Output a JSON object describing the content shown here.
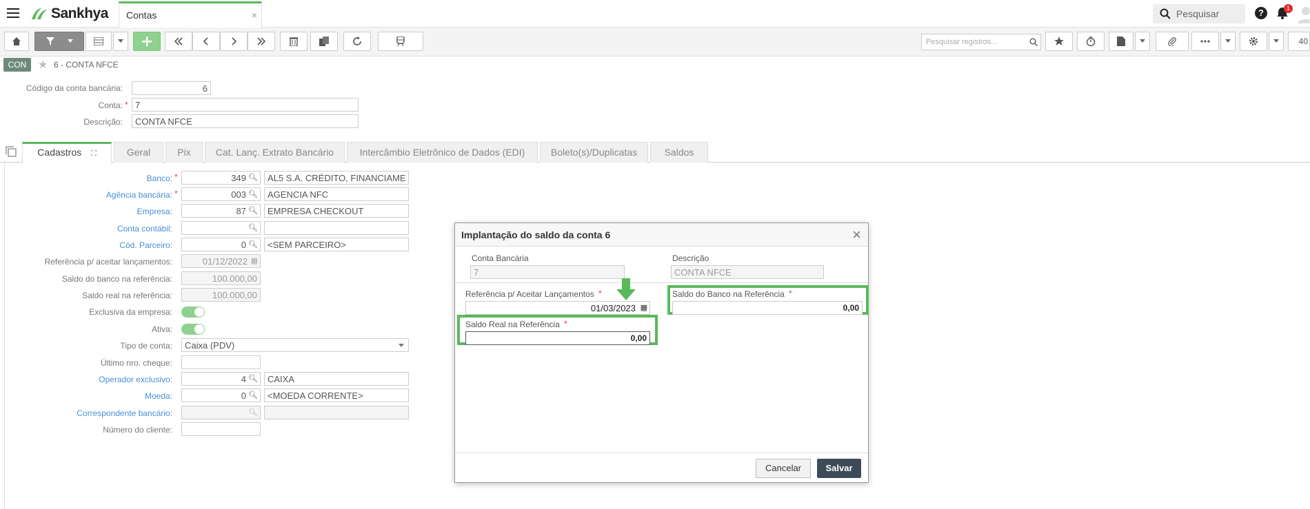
{
  "header": {
    "brand": "Sankhya",
    "tab_title": "Contas",
    "tab_close": "×",
    "search_label": "Pesquisar",
    "help": "?",
    "notifications_count": "1"
  },
  "toolbar": {
    "search_placeholder": "Pesquisar registros...",
    "page_size": "40"
  },
  "record": {
    "badge": "CON",
    "title": "6 - CONTA NFCE",
    "codigo_label": "Código da conta bancária:",
    "codigo_value": "6",
    "conta_label": "Conta:",
    "conta_value": "7",
    "descricao_label": "Descrição:",
    "descricao_value": "CONTA NFCE"
  },
  "tabs": [
    {
      "label": "Cadastros"
    },
    {
      "label": "Geral"
    },
    {
      "label": "Pix"
    },
    {
      "label": "Cat. Lanç. Extrato Bancário"
    },
    {
      "label": "Intercâmbio Eletrônico de Dados (EDI)"
    },
    {
      "label": "Boleto(s)/Duplicatas"
    },
    {
      "label": "Saldos"
    }
  ],
  "form": {
    "banco_label": "Banco:",
    "banco_code": "349",
    "banco_name": "AL5 S.A. CRÉDITO, FINANCIAME",
    "agencia_label": "Agência bancária:",
    "agencia_code": "003",
    "agencia_name": "AGENCIA NFC",
    "empresa_label": "Empresa:",
    "empresa_code": "87",
    "empresa_name": "EMPRESA CHECKOUT",
    "conta_contabil_label": "Conta contábil:",
    "parceiro_label": "Cód. Parceiro:",
    "parceiro_code": "0",
    "parceiro_name": "<SEM PARCEIRO>",
    "referencia_label": "Referência p/ aceitar lançamentos:",
    "referencia_value": "01/12/2022",
    "saldo_banco_label": "Saldo do banco na referência:",
    "saldo_banco_value": "100.000,00",
    "saldo_real_label": "Saldo real na referência:",
    "saldo_real_value": "100.000,00",
    "exclusiva_label": "Exclusiva da empresa:",
    "ativa_label": "Ativa:",
    "tipo_label": "Tipo de conta:",
    "tipo_value": "Caixa (PDV)",
    "ultimo_cheque_label": "Último nro. cheque:",
    "operador_label": "Operador exclusivo:",
    "operador_code": "4",
    "operador_name": "CAIXA",
    "moeda_label": "Moeda:",
    "moeda_code": "0",
    "moeda_name": "<MOEDA CORRENTE>",
    "correspondente_label": "Correspondente bancário:",
    "numero_cliente_label": "Número do cliente:"
  },
  "modal": {
    "title": "Implantação do saldo da conta 6",
    "close": "×",
    "conta_bancaria_label": "Conta Bancária",
    "conta_bancaria_value": "7",
    "descricao_label": "Descrição",
    "descricao_value": "CONTA NFCE",
    "referencia_label": "Referência p/ Aceitar Lançamentos",
    "referencia_value": "01/03/2023",
    "saldo_banco_label": "Saldo do Banco na Referência",
    "saldo_banco_value": "0,00",
    "saldo_real_label": "Saldo Real na Referência",
    "saldo_real_value": "0,00",
    "cancel_label": "Cancelar",
    "save_label": "Salvar",
    "highlight_color": "#5cb85c"
  },
  "colors": {
    "accent_green": "#5cb85c",
    "link_blue": "#4a8fd6",
    "required_red": "#e04040",
    "save_button": "#3d4a57"
  },
  "icons": [
    "menu-icon",
    "sankhya-logo-icon",
    "search-icon",
    "help-icon",
    "bell-icon",
    "user-icon",
    "home-icon",
    "filter-icon",
    "grid-icon",
    "plus-icon",
    "first-page-icon",
    "prev-icon",
    "next-icon",
    "last-page-icon",
    "trash-icon",
    "copy-icon",
    "refresh-icon",
    "train-icon",
    "star-icon",
    "timer-icon",
    "report-icon",
    "attach-icon",
    "more-icon",
    "gear-icon",
    "calendar-icon",
    "arrow-down-icon"
  ]
}
